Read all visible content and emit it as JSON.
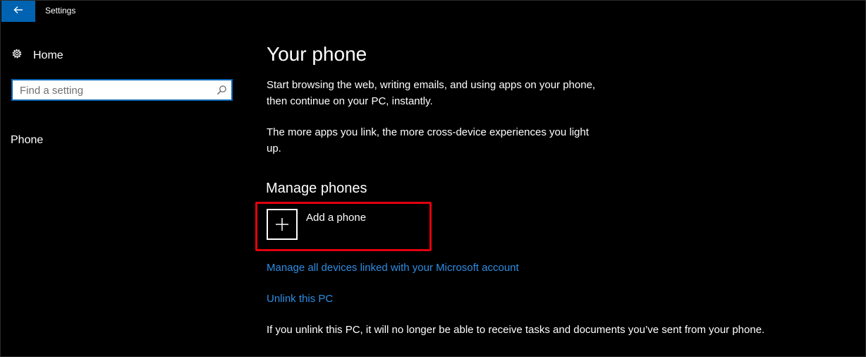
{
  "window": {
    "title": "Settings",
    "back_icon": "back-arrow-icon",
    "accent_color": "#0063b1"
  },
  "sidebar": {
    "home_icon": "gear-icon",
    "home_label": "Home",
    "search_placeholder": "Find a setting",
    "search_value": "",
    "search_icon": "search-icon",
    "items": [
      {
        "label": "Phone"
      }
    ]
  },
  "main": {
    "title": "Your phone",
    "paragraph1": "Start browsing the web, writing emails, and using apps on your phone, then continue on your PC, instantly.",
    "paragraph2": "The more apps you link, the more cross-device experiences you light up.",
    "section_title": "Manage phones",
    "add_phone_label": "Add a phone",
    "add_phone_icon": "plus-icon",
    "highlight_color": "#e3000f",
    "link_manage": "Manage all devices linked with your Microsoft account",
    "link_unlink": "Unlink this PC",
    "link_color": "#2d8de3",
    "unlink_note": "If you unlink this PC, it will no longer be able to receive tasks and documents you’ve sent from your phone."
  }
}
